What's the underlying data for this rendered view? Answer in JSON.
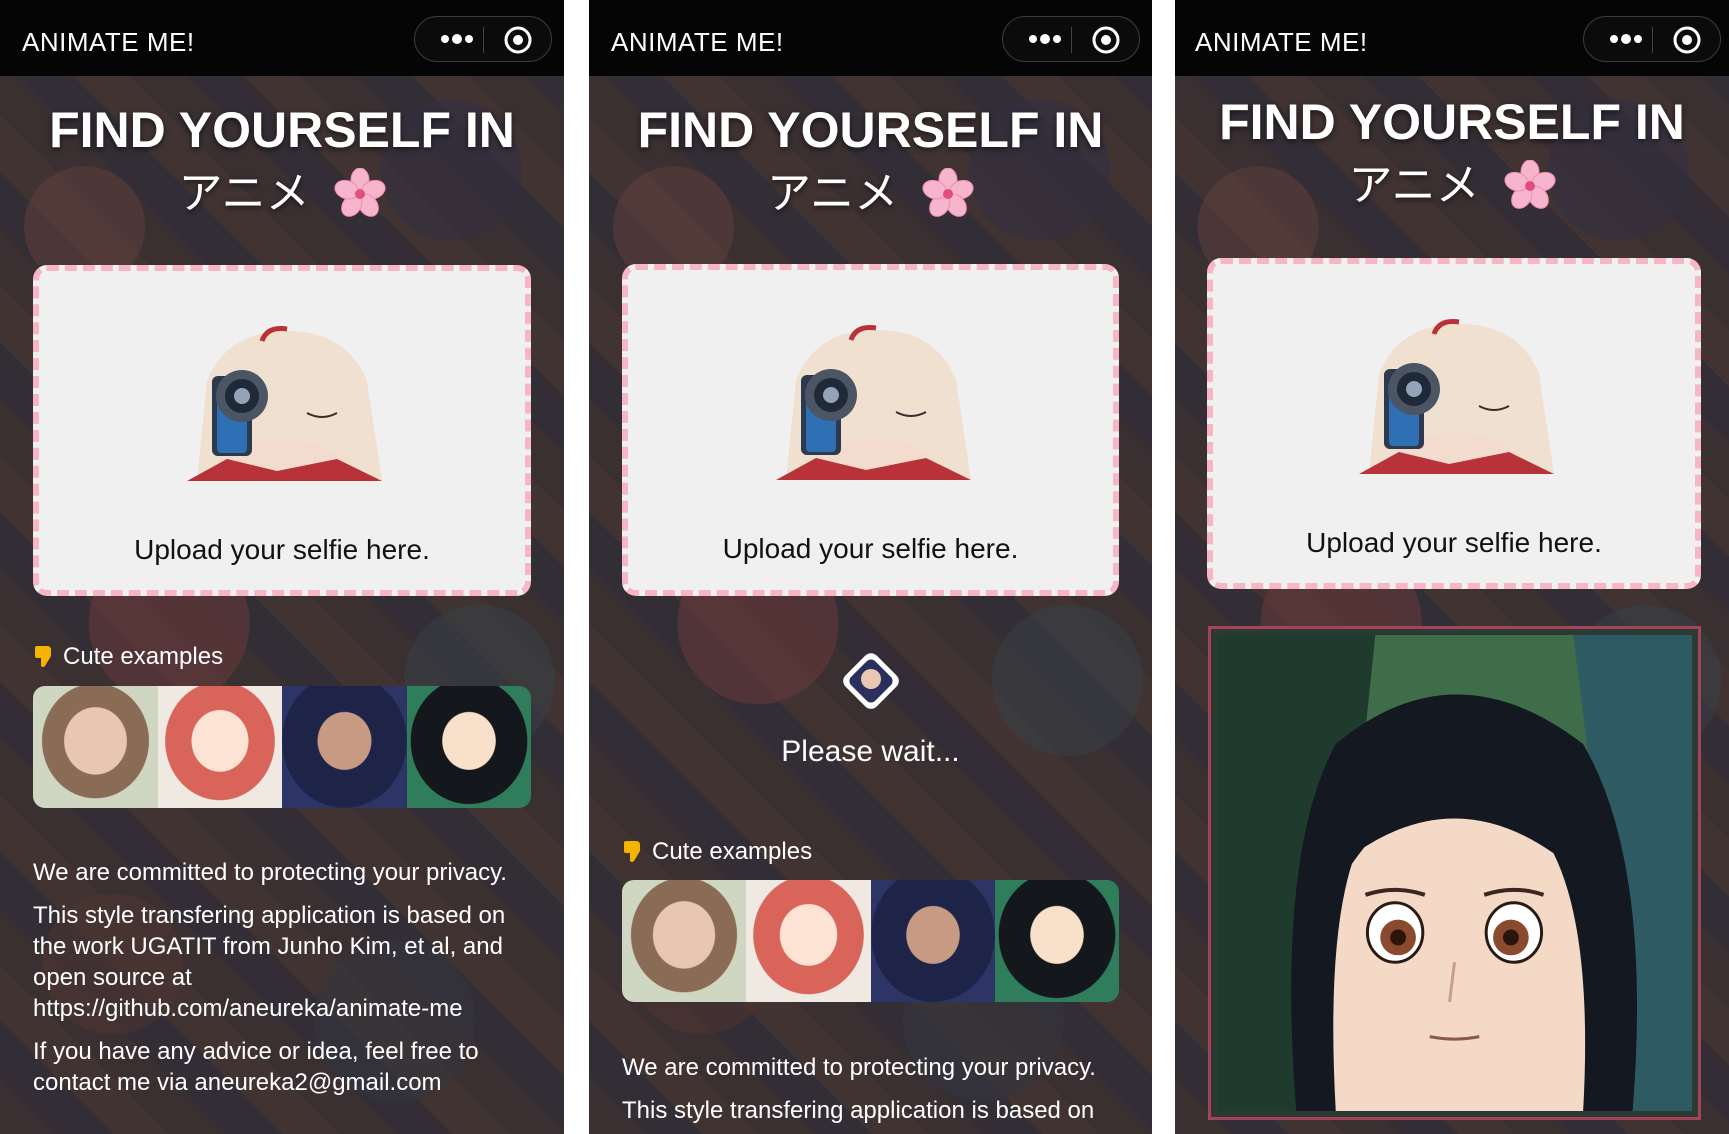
{
  "app": {
    "title": "ANIMATE ME!"
  },
  "hero": {
    "line1": "FIND YOURSELF IN",
    "line2": "アニメ"
  },
  "upload": {
    "label": "Upload your selfie here."
  },
  "examples": {
    "heading": "Cute examples"
  },
  "loading": {
    "text": "Please wait..."
  },
  "privacy": {
    "line1": "We are committed to protecting your privacy.",
    "line2": "This style transfering application is based on the work UGATIT from Junho Kim, et al, and open source at https://github.com/aneureka/animate-me",
    "line3": "If you have any advice or idea, feel free to contact me via aneureka2@gmail.com",
    "line2_partial": "This style transfering application is based on"
  },
  "icons": {
    "more": "more-dots-icon",
    "close": "target-close-icon",
    "blossom": "cherry-blossom-icon",
    "hand": "pointing-down-hand-icon"
  },
  "colors": {
    "dashed_border": "#f7b6c5",
    "result_border": "#a4435a",
    "topbar": "#050505"
  }
}
